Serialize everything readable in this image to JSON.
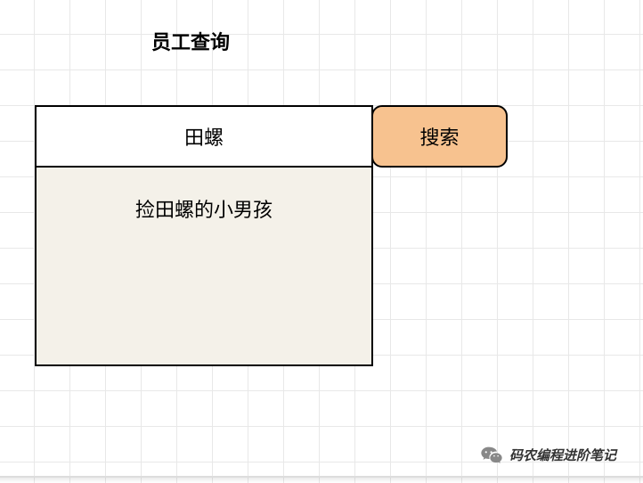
{
  "header": {
    "title": "员工查询"
  },
  "search": {
    "input_value": "田螺",
    "button_label": "搜索"
  },
  "results": {
    "items": [
      "捡田螺的小男孩"
    ]
  },
  "watermark": {
    "icon_name": "wechat-icon",
    "text": "码农编程进阶笔记"
  }
}
